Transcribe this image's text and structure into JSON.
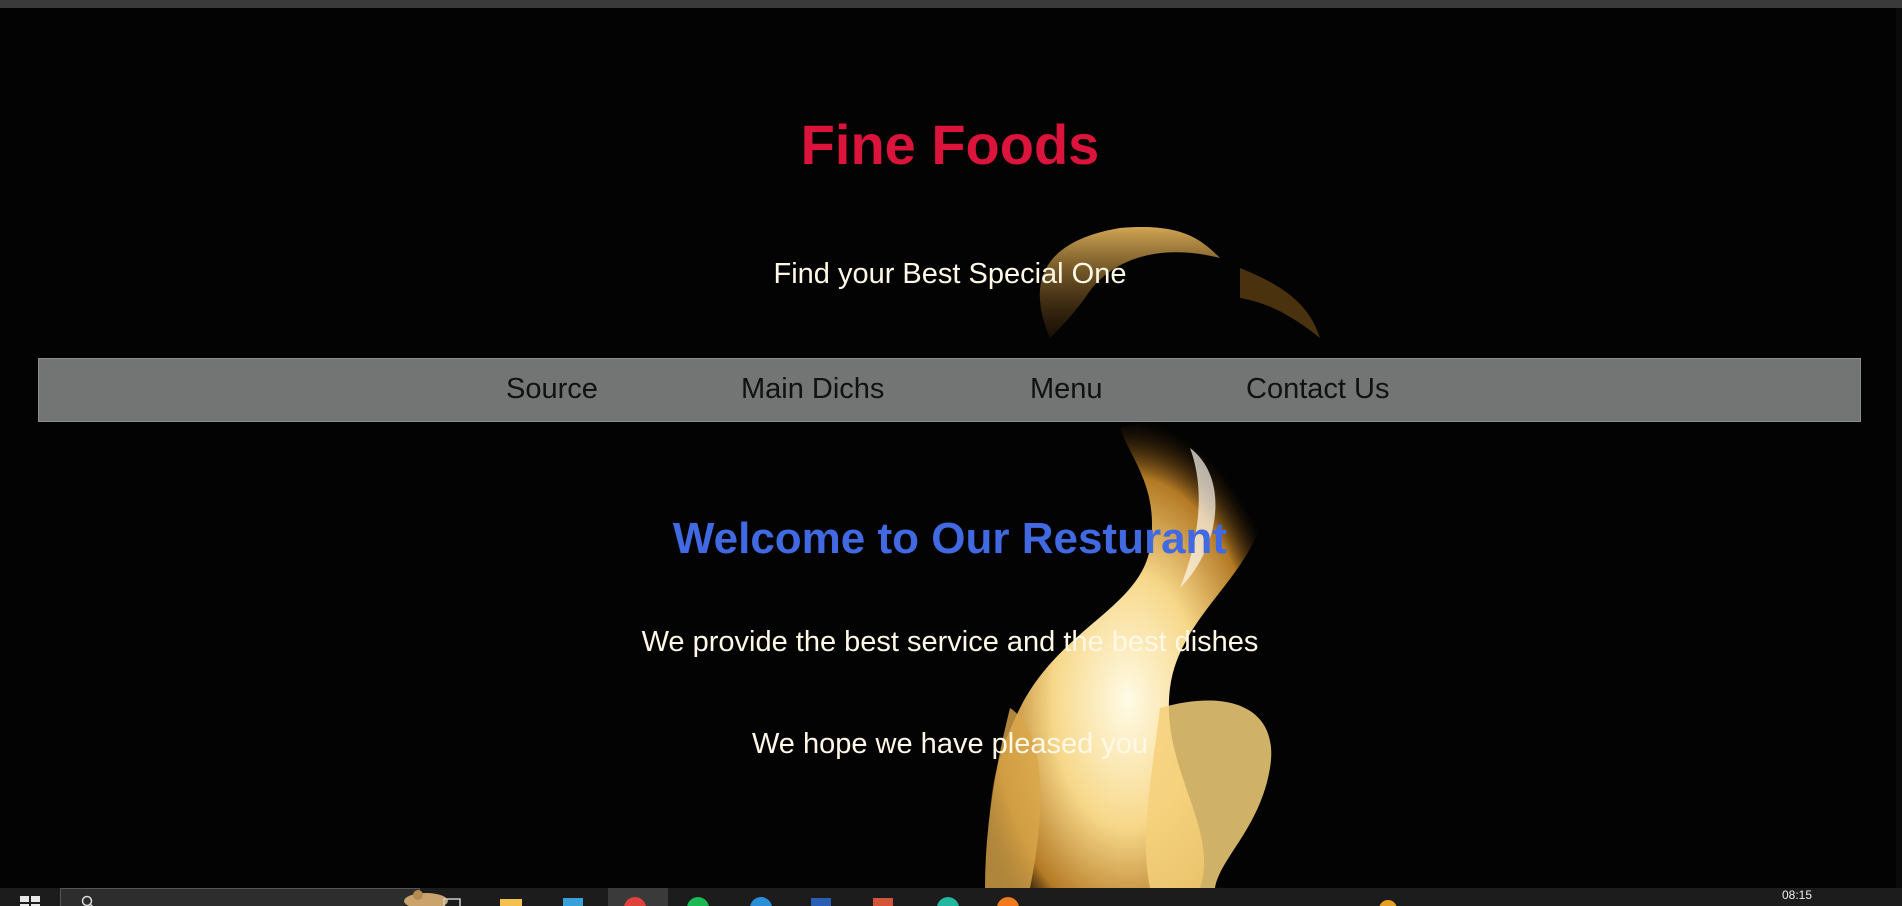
{
  "site": {
    "title": "Fine Foods",
    "tagline": "Find your Best Special One"
  },
  "nav": {
    "items": [
      {
        "label": "Source"
      },
      {
        "label": "Main Dichs"
      },
      {
        "label": "Menu"
      },
      {
        "label": "Contact Us"
      }
    ]
  },
  "main": {
    "heading": "Welcome to Our Resturant",
    "line1": "We provide the best service and the best dishes",
    "line2": "We hope we have pleased you"
  },
  "taskbar": {
    "clock": "08:15",
    "icons": [
      "windows-start-icon",
      "search-icon",
      "cortana-icon",
      "task-view-icon",
      "file-explorer-icon",
      "store-icon",
      "chrome-icon",
      "spotify-icon",
      "edge-icon",
      "word-icon",
      "powerpoint-icon",
      "browser-icon",
      "firefox-icon"
    ]
  },
  "colors": {
    "title": "#dc143c",
    "heading": "#4169e1",
    "body_text": "#fff8e7",
    "nav_bg": "#737574"
  }
}
